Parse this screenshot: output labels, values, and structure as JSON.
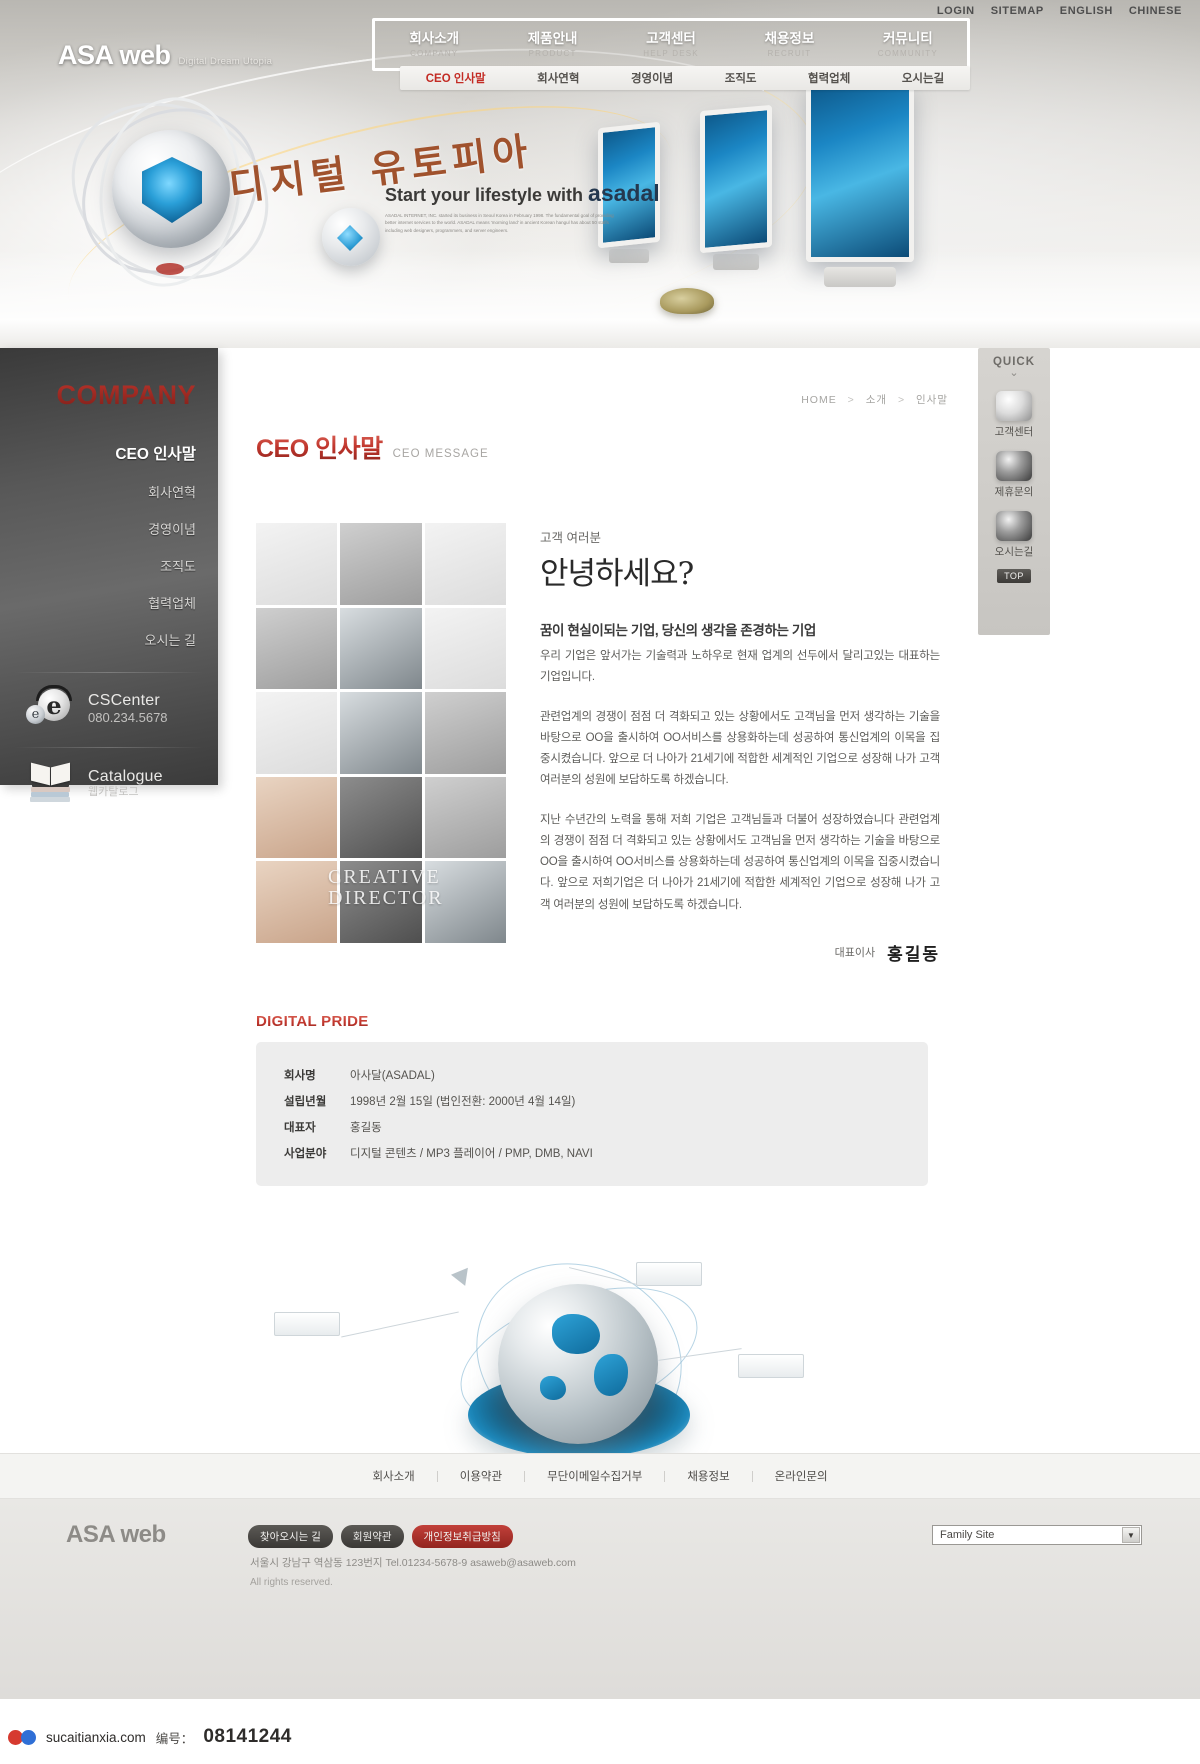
{
  "utility": {
    "links": [
      "LOGIN",
      "SITEMAP",
      "ENGLISH",
      "CHINESE"
    ]
  },
  "logo": {
    "main": "ASA web",
    "sub": "Digital Dream Utopia"
  },
  "nav": {
    "items": [
      {
        "kr": "회사소개",
        "en": "COMPANY"
      },
      {
        "kr": "제품안내",
        "en": "PRODUCT"
      },
      {
        "kr": "고객센터",
        "en": "HELP DESK"
      },
      {
        "kr": "채용정보",
        "en": "RECRUIT"
      },
      {
        "kr": "커뮤니티",
        "en": "COMMUNITY"
      }
    ]
  },
  "subnav": {
    "items": [
      "CEO 인사말",
      "회사연혁",
      "경영이념",
      "조직도",
      "협력업체",
      "오시는길"
    ],
    "active_index": 0
  },
  "hero": {
    "script_text": "디지털 유토피아",
    "tagline_prefix": "Start your lifestyle with ",
    "tagline_brand": "asadal",
    "tagline_body": "ASADAL INTERNET, INC. started its business in Seoul Korea in February 1998. The fundamental goal of providing better internet services to the world. ASADAL means 'morning land' in ancient Korean hangul has about 50 staffs including web designers, programmers, and server engineers."
  },
  "sidebar": {
    "title": "COMPANY",
    "items": [
      {
        "label": "CEO 인사말",
        "active": true
      },
      {
        "label": "회사연혁",
        "active": false
      },
      {
        "label": "경영이념",
        "active": false
      },
      {
        "label": "조직도",
        "active": false
      },
      {
        "label": "협력업체",
        "active": false
      },
      {
        "label": "오시는 길",
        "active": false
      }
    ],
    "cscenter": {
      "title": "CSCenter",
      "phone": "080.234.5678"
    },
    "catalogue": {
      "title": "Catalogue",
      "sub": "웹카탈로그"
    }
  },
  "breadcrumb": {
    "home": "HOME",
    "level1": "소개",
    "level2": "인사말",
    "separator": ">"
  },
  "page": {
    "title_kr": "CEO 인사말",
    "title_en": "CEO MESSAGE"
  },
  "mosaic": {
    "caption_line1": "CREATIVE",
    "caption_line2": "DIRECTOR"
  },
  "ceo": {
    "greet_small": "고객 여러분",
    "greet_big": "안녕하세요?",
    "lead": "꿈이 현실이되는 기업, 당신의 생각을 존경하는 기업",
    "para1": "우리 기업은 앞서가는 기술력과 노하우로 현재 업계의 선두에서 달리고있는 대표하는 기업입니다.",
    "para2": "관련업계의 경쟁이 점점 더 격화되고 있는 상황에서도 고객님을 먼저 생각하는 기술을 바탕으로 OO을 출시하여 OO서비스를 상용화하는데 성공하여 통신업계의 이목을 집중시켰습니다.\n앞으로 더 나아가 21세기에 적합한 세계적인 기업으로 성장해 나가 고객 여러분의 성원에 보답하도록 하겠습니다.",
    "para3": "지난 수년간의 노력을 통해 저희 기업은 고객님들과 더불어 성장하였습니다 관련업계의 경쟁이 점점 더 격화되고 있는 상황에서도 고객님을 먼저 생각하는 기술을 바탕으로 OO을 출시하여 OO서비스를 상용화하는데 성공하여 통신업계의 이목을 집중시켰습니다.  앞으로 저희기업은 더 나아가 21세기에 적합한 세계적인 기업으로 성장해 나가 고객 여러분의 성원에 보답하도록 하겠습니다.",
    "sign_role": "대표이사",
    "sign_name": "홍길동"
  },
  "pride": {
    "title": "DIGITAL PRIDE",
    "rows": [
      {
        "key": "회사명",
        "value": "아사달(ASADAL)"
      },
      {
        "key": "설립년월",
        "value": "1998년 2월 15일 (법인전환: 2000년 4월 14일)"
      },
      {
        "key": "대표자",
        "value": "홍길동"
      },
      {
        "key": "사업분야",
        "value": "디지털 콘텐츠 / MP3 플레이어 / PMP, DMB, NAVI"
      }
    ]
  },
  "quick": {
    "title": "QUICK",
    "chevron": "⌄",
    "items": [
      {
        "label": "고객센터",
        "icon": "headset-icon"
      },
      {
        "label": "제휴문의",
        "icon": "handshake-icon"
      },
      {
        "label": "오시는길",
        "icon": "globe-icon"
      }
    ],
    "top_label": "TOP"
  },
  "footer_nav": {
    "links": [
      "회사소개",
      "이용약관",
      "무단이메일수집거부",
      "채용정보",
      "온라인문의"
    ]
  },
  "footer": {
    "logo": "ASA web",
    "buttons": [
      {
        "label": "찾아오시는 길",
        "style": "dark"
      },
      {
        "label": "회원약관",
        "style": "dark"
      },
      {
        "label": "개인정보취급방침",
        "style": "red"
      }
    ],
    "address": "서울시 강남구 역삼동 123번지  Tel.01234-5678-9  asaweb@asaweb.com",
    "copyright": "All rights reserved.",
    "family_site": "Family Site",
    "family_arrow": "▼"
  },
  "watermark": {
    "site": "sucaitianxia.com",
    "label": "编号：",
    "number": "08141244"
  },
  "colors": {
    "accent_red": "#c0352c",
    "sidebar_dark": "#4a4a4a",
    "panel_gray": "#ededed",
    "link_gray": "#55534f"
  }
}
